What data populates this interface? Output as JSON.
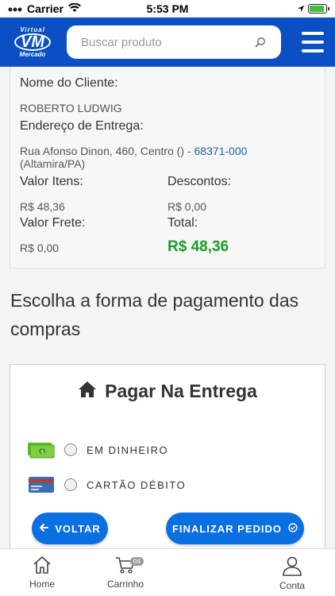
{
  "status_bar": {
    "carrier": "Carrier",
    "time": "5:53 PM",
    "battery_level": 0.9
  },
  "header": {
    "logo": {
      "top": "Virtual",
      "main": "VM",
      "bottom": "Mercado"
    },
    "search": {
      "placeholder": "Buscar produto",
      "value": ""
    },
    "icons": {
      "search": "search-icon",
      "menu": "hamburger-menu-icon"
    },
    "color": "#0a4fc4"
  },
  "summary": {
    "client_label": "Nome do Cliente:",
    "client_value": "ROBERTO LUDWIG",
    "address_label": "Endereço de Entrega:",
    "address_prefix": "Rua Afonso Dinon, 460, Centro () - ",
    "address_cep": "68371-000",
    "address_city": " (Altamira/PA)",
    "items_label": "Valor Itens:",
    "items_value": "R$ 48,36",
    "discount_label": "Descontos:",
    "discount_value": "R$ 0,00",
    "freight_label": "Valor Frete:",
    "freight_value": "R$ 0,00",
    "total_label": "Total:",
    "total_value": "R$ 48,36",
    "total_color": "#1f9a2d"
  },
  "payment": {
    "title": "Escolha a forma de pagamento das compras",
    "card_title": "Pagar Na Entrega",
    "card_icon": "home-icon",
    "options": [
      {
        "label": "EM DINHEIRO",
        "icon": "cash-icon",
        "selected": false
      },
      {
        "label": "CARTÃO DÉBITO",
        "icon": "credit-card-icon",
        "selected": false
      }
    ],
    "back_label": "VOLTAR",
    "finish_label": "FINALIZAR PEDIDO",
    "button_color": "#0a6fe0"
  },
  "tabbar": {
    "home_label": "Home",
    "cart_label": "Carrinho",
    "cart_badge": "04",
    "account_label": "Conta"
  }
}
